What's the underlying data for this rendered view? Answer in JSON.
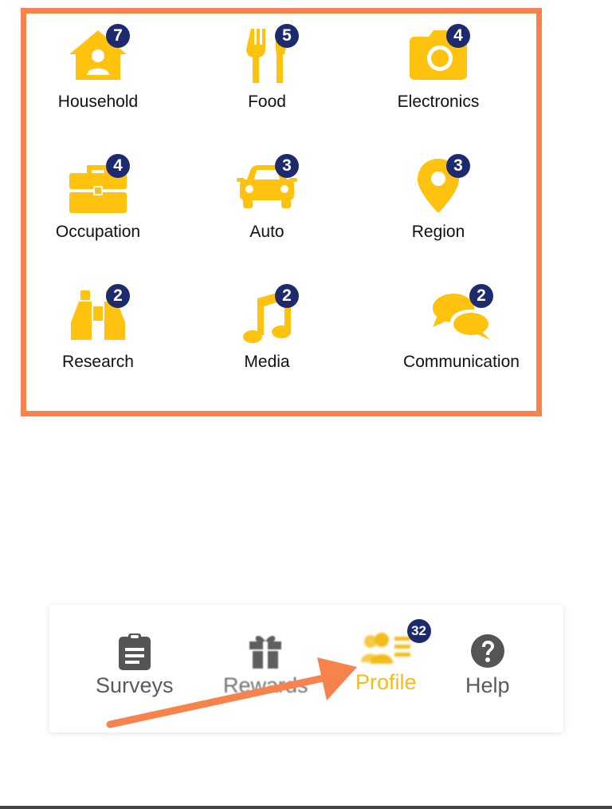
{
  "colors": {
    "accent": "#F7824B",
    "icon_yellow": "#FFC20E",
    "badge_navy": "#1D2A6E",
    "active_nav": "#F2BC1B",
    "inactive_nav": "#5a5a5a"
  },
  "categories": [
    {
      "label": "Household",
      "count": "7",
      "icon": "house-person-icon"
    },
    {
      "label": "Food",
      "count": "5",
      "icon": "fork-knife-icon"
    },
    {
      "label": "Electronics",
      "count": "4",
      "icon": "camera-icon"
    },
    {
      "label": "Occupation",
      "count": "4",
      "icon": "toolbox-icon"
    },
    {
      "label": "Auto",
      "count": "3",
      "icon": "car-icon"
    },
    {
      "label": "Region",
      "count": "3",
      "icon": "location-pin-icon"
    },
    {
      "label": "Research",
      "count": "2",
      "icon": "binoculars-icon"
    },
    {
      "label": "Media",
      "count": "2",
      "icon": "music-note-icon"
    },
    {
      "label": "Communication",
      "count": "2",
      "icon": "chat-bubbles-icon"
    }
  ],
  "nav": {
    "surveys": {
      "label": "Surveys",
      "icon": "clipboard-icon"
    },
    "rewards": {
      "label": "Rewards",
      "icon": "gift-icon"
    },
    "profile": {
      "label": "Profile",
      "icon": "profile-list-icon",
      "badge": "32"
    },
    "help": {
      "label": "Help",
      "icon": "question-circle-icon"
    }
  }
}
